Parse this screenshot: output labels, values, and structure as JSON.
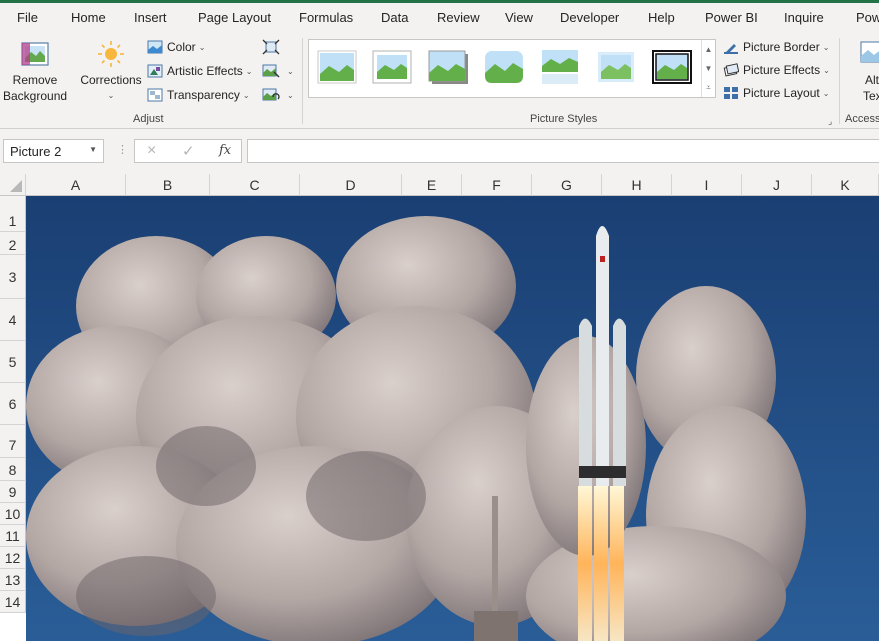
{
  "ribbon_tabs": [
    "File",
    "Home",
    "Insert",
    "Page Layout",
    "Formulas",
    "Data",
    "Review",
    "View",
    "Developer",
    "Help",
    "Power BI",
    "Inquire",
    "Pow"
  ],
  "adjust": {
    "remove_background": [
      "Remove",
      "Background"
    ],
    "corrections": "Corrections",
    "color": "Color",
    "artistic_effects": "Artistic Effects",
    "transparency": "Transparency",
    "label": "Adjust"
  },
  "picture_styles": {
    "label": "Picture Styles",
    "picture_border": "Picture Border",
    "picture_effects": "Picture Effects",
    "picture_layout": "Picture Layout"
  },
  "accessibility": {
    "alt_text": [
      "Alt",
      "Tex"
    ],
    "label": "Accessi"
  },
  "formula_bar": {
    "name_box": "Picture 2",
    "cancel_icon": "×",
    "enter_icon": "✓",
    "fx_label": "fx",
    "value": ""
  },
  "columns": [
    "A",
    "B",
    "C",
    "D",
    "E",
    "F",
    "G",
    "H",
    "I",
    "J",
    "K"
  ],
  "rows": [
    "1",
    "2",
    "3",
    "4",
    "5",
    "6",
    "7",
    "8",
    "9",
    "10",
    "11",
    "12",
    "13",
    "14"
  ],
  "colors": {
    "accent": "#217346",
    "sky": "#1f4f86"
  }
}
